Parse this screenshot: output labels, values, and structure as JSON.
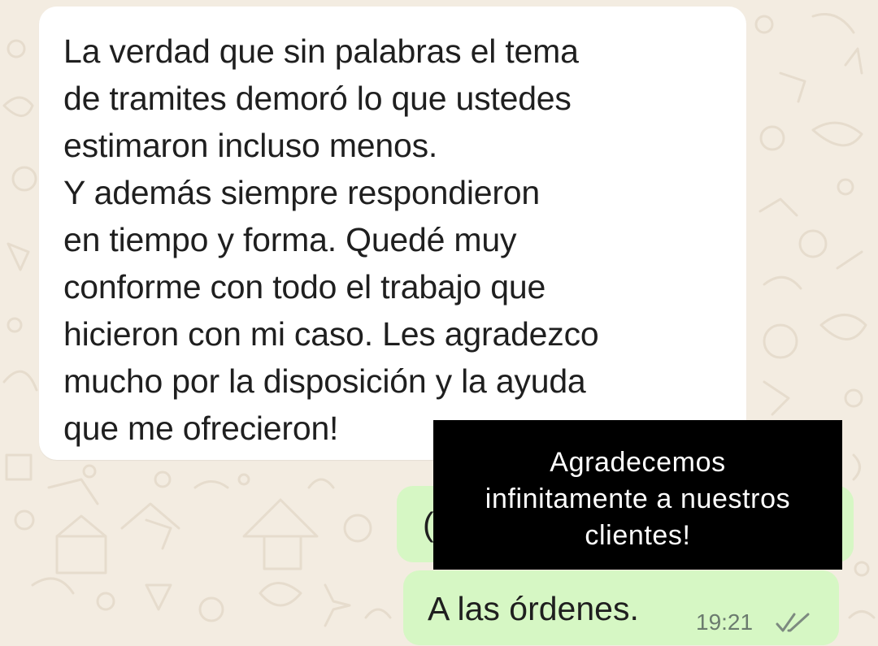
{
  "chat": {
    "incoming": {
      "lines": [
        "La verdad que sin palabras el tema",
        "de tramites demoró lo que ustedes",
        "estimaron incluso menos.",
        "Y además siempre respondieron",
        "en tiempo y forma. Quedé muy",
        "conforme con todo el trabajo que",
        "hicieron con mi caso. Les agradezco",
        "mucho por la disposición y la ayuda",
        "que me ofrecieron!"
      ]
    },
    "outgoing_partial": {
      "visible_text": "("
    },
    "outgoing_reply": {
      "text": "A las órdenes.",
      "time": "19:21",
      "status_icon": "double-check-icon"
    }
  },
  "overlay": {
    "lines": [
      "Agradecemos",
      "infinitamente a nuestros",
      "clientes!"
    ]
  },
  "colors": {
    "background": "#f3ece1",
    "incoming_bubble": "#ffffff",
    "outgoing_bubble": "#d6f7c4",
    "overlay": "#000000",
    "overlay_text": "#ffffff",
    "timestamp": "#6b7b6e"
  }
}
